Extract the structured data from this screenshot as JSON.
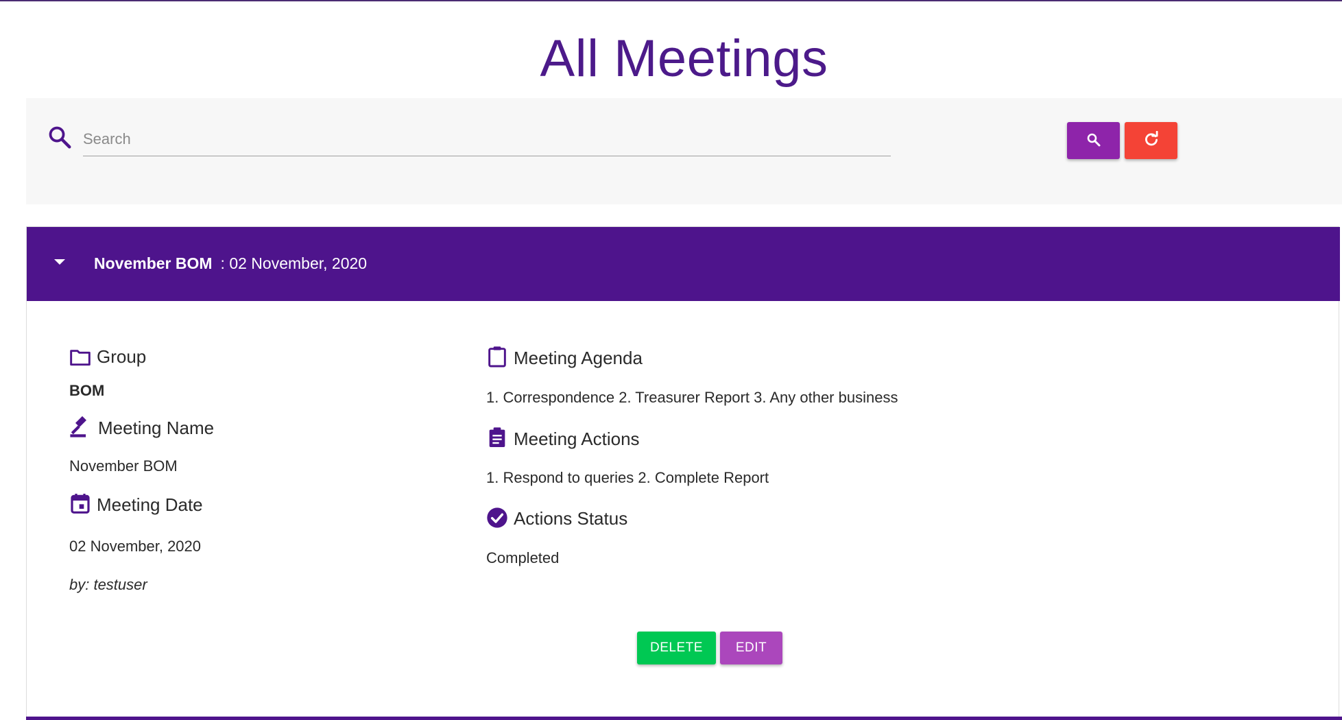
{
  "page": {
    "title": "All Meetings"
  },
  "search": {
    "placeholder": "Search",
    "value": ""
  },
  "colors": {
    "brand_purple": "#4e148c",
    "search_button": "#8e24aa",
    "reset_button": "#f44336",
    "delete_button": "#00c853",
    "edit_button": "#ab47bc"
  },
  "icons": {
    "search": "search-icon",
    "search_button": "magnify-icon",
    "reset_button": "refresh-icon",
    "expand": "caret-down-icon",
    "group": "folder-icon",
    "meeting_name": "gavel-icon",
    "meeting_date": "calendar-icon",
    "agenda": "clipboard-icon",
    "actions": "clipboard-list-icon",
    "status": "check-circle-icon"
  },
  "meeting": {
    "header_name": "November BOM",
    "header_date": ": 02 November, 2020",
    "group_label": "Group",
    "group_value": "BOM",
    "name_label": "Meeting Name",
    "name_value": "November BOM",
    "date_label": "Meeting Date",
    "date_value": "02 November, 2020",
    "author": "by: testuser",
    "agenda_label": "Meeting Agenda",
    "agenda_value": "1. Correspondence 2. Treasurer Report 3. Any other business",
    "actions_label": "Meeting Actions",
    "actions_value": "1. Respond to queries 2. Complete Report",
    "status_label": "Actions Status",
    "status_value": "Completed",
    "delete_label": "DELETE",
    "edit_label": "EDIT"
  }
}
